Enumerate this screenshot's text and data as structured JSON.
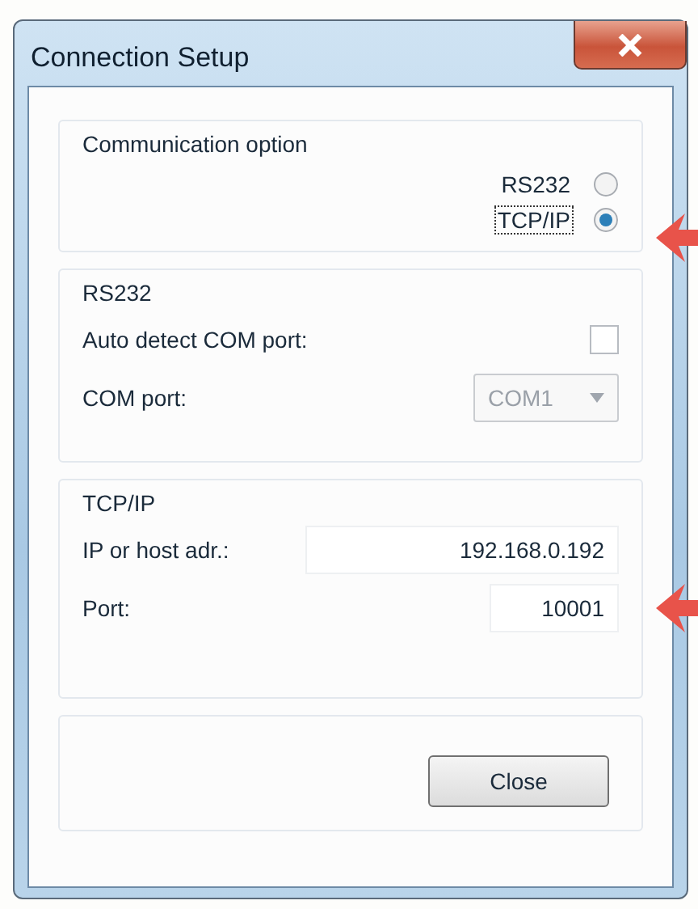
{
  "window": {
    "title": "Connection Setup"
  },
  "communication_option": {
    "label": "Communication option",
    "options": [
      {
        "label": "RS232",
        "selected": false,
        "focused": false
      },
      {
        "label": "TCP/IP",
        "selected": true,
        "focused": true
      }
    ]
  },
  "rs232": {
    "label": "RS232",
    "auto_detect": {
      "label": "Auto detect COM port:",
      "checked": false
    },
    "com_port": {
      "label": "COM port:",
      "value": "COM1",
      "disabled": true
    }
  },
  "tcpip": {
    "label": "TCP/IP",
    "fields": [
      {
        "label": "IP or host adr.:",
        "value": "192.168.0.192"
      },
      {
        "label": "Port:",
        "value": "10001"
      }
    ]
  },
  "buttons": [
    {
      "label": "Close"
    }
  ]
}
